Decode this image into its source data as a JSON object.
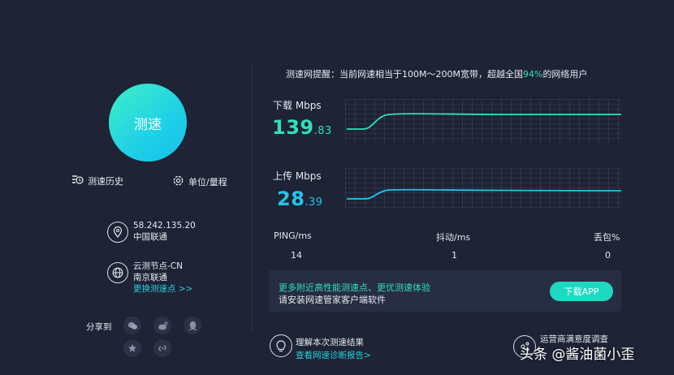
{
  "left": {
    "speed_button": "测速",
    "history": "测速历史",
    "units": "单位/量程",
    "ip": "58.242.135.20",
    "isp": "中国联通",
    "node_name": "云测节点-CN",
    "node_isp": "南京联通",
    "change_node": "更换测速点 >>",
    "share_label": "分享到"
  },
  "notice": {
    "prefix": "测速网提醒：当前网速相当于100M～200M宽带，超越全国",
    "percent": "94%",
    "suffix": "的网络用户"
  },
  "download": {
    "label": "下载 Mbps",
    "int": "139",
    "dec": ".83",
    "color": "#2fe0b8"
  },
  "upload": {
    "label": "上传 Mbps",
    "int": "28",
    "dec": ".39",
    "color": "#23c4e8"
  },
  "stats": {
    "ping_label": "PING/ms",
    "ping_value": "14",
    "jitter_label": "抖动/ms",
    "jitter_value": "1",
    "loss_label": "丢包%",
    "loss_value": "0"
  },
  "promo": {
    "line1": "更多附近高性能测速点、更优测速体验",
    "line2": "请安装网速管家客户端软件",
    "button": "下载APP"
  },
  "bottom": {
    "result_title": "理解本次测速结果",
    "result_link": "查看网速诊断报告>",
    "survey_title": "运营商满意度调查"
  },
  "watermark": "头条 @酱油菌小歪"
}
